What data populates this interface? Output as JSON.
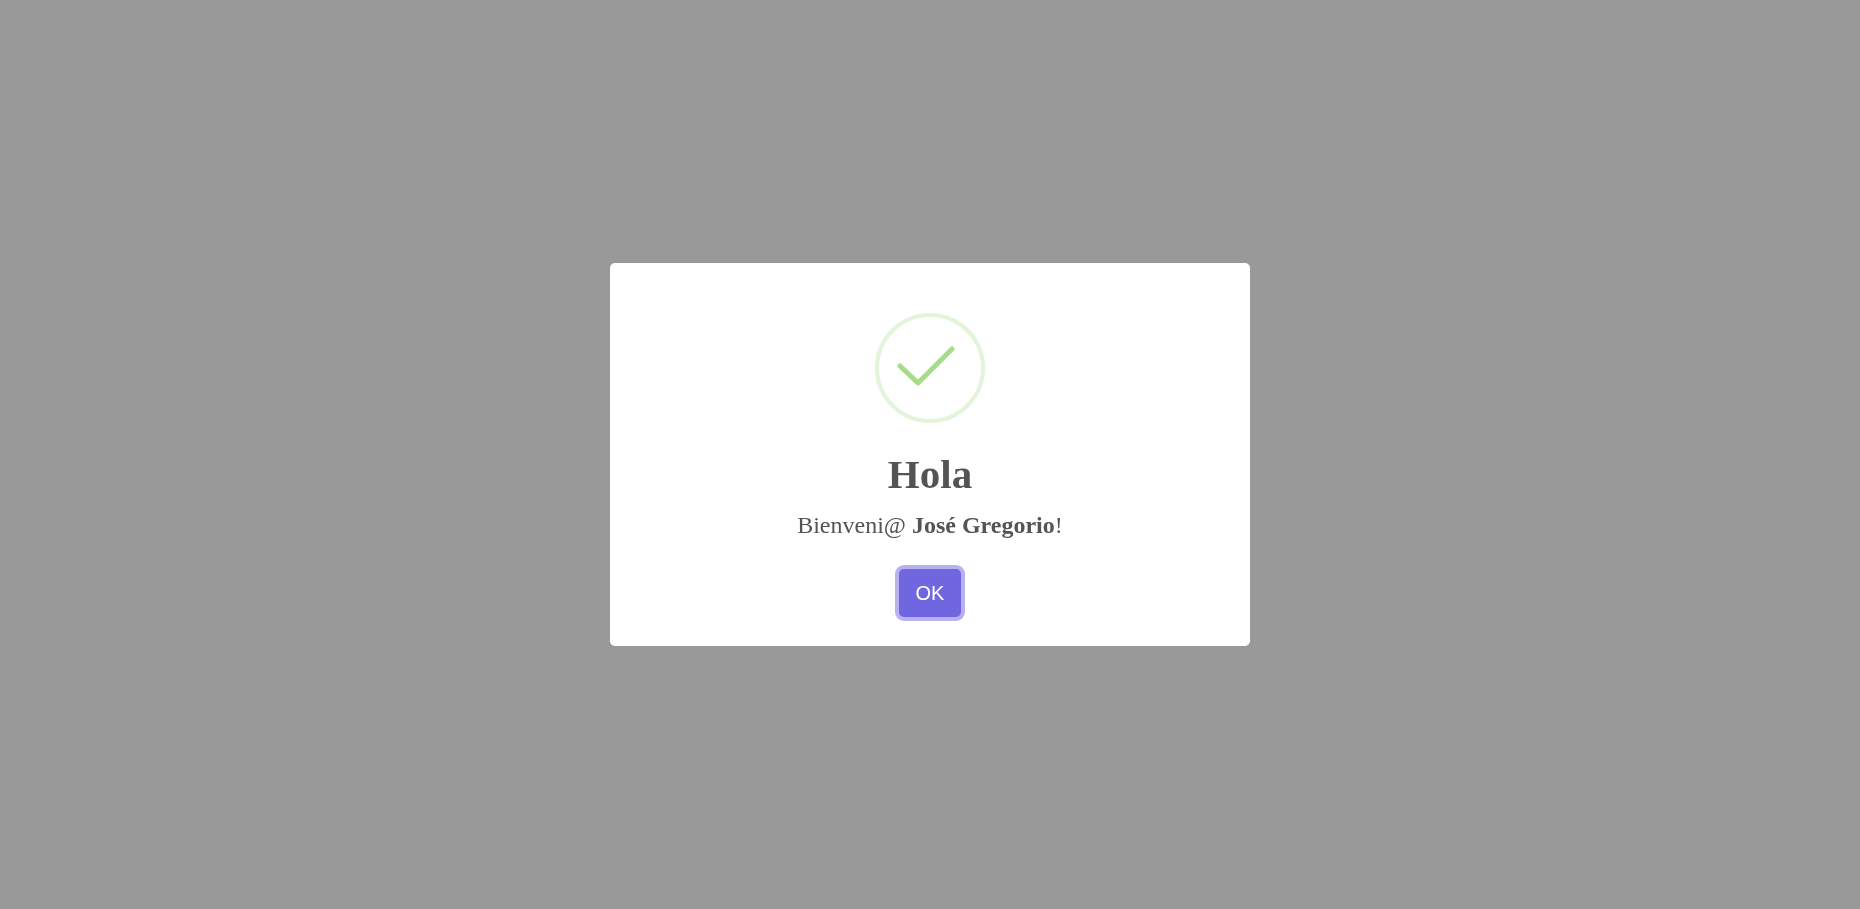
{
  "dialog": {
    "icon": {
      "kind": "success"
    },
    "title": "Hola",
    "message": "Bienveni@ **José Gregorio**!",
    "buttons": [
      {
        "label": "OK",
        "focused": true
      }
    ]
  }
}
